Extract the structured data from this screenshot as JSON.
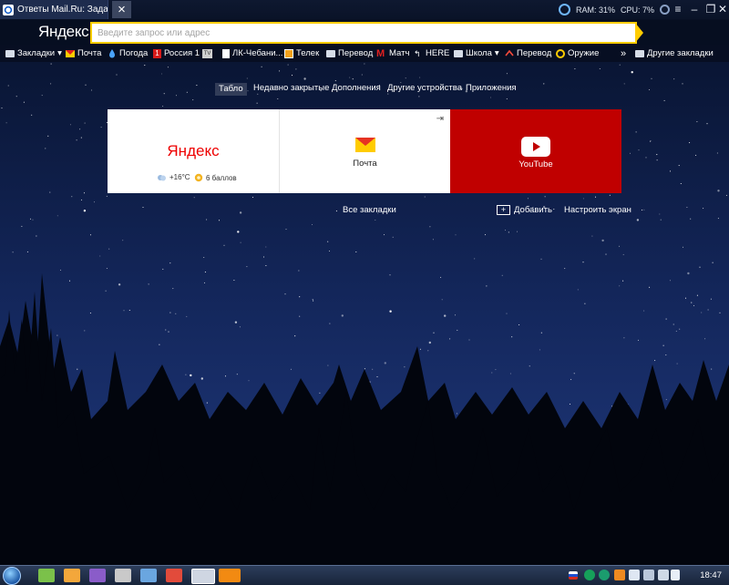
{
  "tab": {
    "title": "Ответы Mail.Ru: Задать воп",
    "close_icon": "×"
  },
  "system": {
    "ram": "RAM: 31%",
    "cpu": "CPU: 7%"
  },
  "window_controls": {
    "menu": "≡",
    "minimize": "–",
    "restore": "❐",
    "close": "✕"
  },
  "browser": {
    "logo": "Яндекс",
    "search_placeholder": "Введите запрос или адрес",
    "accent_color": "#ffcc00"
  },
  "bookmarks": {
    "items": [
      {
        "label": "Закладки",
        "icon": "folder-icon",
        "has_menu": true
      },
      {
        "label": "Почта",
        "icon": "mail-icon"
      },
      {
        "label": "Погода",
        "icon": "weather-drop-icon"
      },
      {
        "label": "Россия 1",
        "icon": "russia1-icon"
      },
      {
        "label": "",
        "icon": "tv-icon"
      },
      {
        "label": "ЛК-Чебани...",
        "icon": "page-icon"
      },
      {
        "label": "Телек",
        "icon": "tv-screen-icon"
      },
      {
        "label": "Перевод",
        "icon": "folder-icon"
      },
      {
        "label": "Матч",
        "icon": "match-m-icon"
      },
      {
        "label": "HERE",
        "icon": "here-icon"
      },
      {
        "label": "Школа",
        "icon": "folder-icon",
        "has_menu": true
      },
      {
        "label": "Перевод",
        "icon": "translate-icon"
      },
      {
        "label": "Оружие",
        "icon": "gun-icon"
      }
    ],
    "overflow": "»",
    "other": "Другие закладки"
  },
  "newtab_nav": {
    "items": [
      "Табло",
      "Недавно закрытые",
      "Дополнения",
      "Другие устройства",
      "Приложения"
    ],
    "active": "Табло"
  },
  "tiles": {
    "yandex": {
      "logo": "Яндекс",
      "temperature": "+16°C",
      "traffic": "6 баллов"
    },
    "mail": {
      "label": "Почта"
    },
    "youtube": {
      "label": "YouTube",
      "color": "#c00000"
    }
  },
  "actions": {
    "all_bookmarks": "Все закладки",
    "add": "Добавить",
    "customize": "Настроить экран"
  },
  "taskbar": {
    "time": "18:47"
  }
}
